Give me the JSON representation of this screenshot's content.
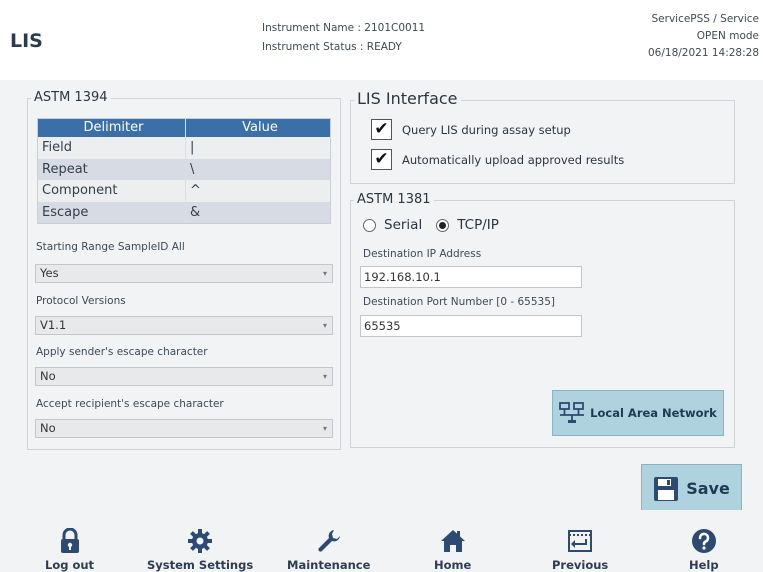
{
  "header": {
    "title": "LIS",
    "instrument_name": "Instrument Name : 2101C0011",
    "instrument_status": "Instrument Status : READY",
    "user": "ServicePSS / Service",
    "mode": "OPEN mode",
    "datetime": "06/18/2021 14:28:28"
  },
  "astm1394": {
    "legend": "ASTM 1394",
    "table_headers": [
      "Delimiter",
      "Value"
    ],
    "rows": [
      {
        "delimiter": "Field",
        "value": "|"
      },
      {
        "delimiter": "Repeat",
        "value": "\\"
      },
      {
        "delimiter": "Component",
        "value": "^"
      },
      {
        "delimiter": "Escape",
        "value": "&"
      }
    ],
    "starting_range_label": "Starting Range SampleID All",
    "starting_range_value": "Yes",
    "protocol_versions_label": "Protocol Versions",
    "protocol_versions_value": "V1.1",
    "sender_escape_label": "Apply sender's escape character",
    "sender_escape_value": "No",
    "recipient_escape_label": "Accept recipient's escape character",
    "recipient_escape_value": "No"
  },
  "lis_interface": {
    "legend": "LIS Interface",
    "query_lis_label": "Query LIS during assay setup",
    "query_lis_checked": true,
    "auto_upload_label": "Automatically upload approved results",
    "auto_upload_checked": true
  },
  "astm1381": {
    "legend": "ASTM 1381",
    "serial_label": "Serial",
    "tcpip_label": "TCP/IP",
    "selected_protocol": "TCP/IP",
    "dest_ip_label": "Destination IP Address",
    "dest_ip_value": "192.168.10.1",
    "dest_port_label": "Destination Port Number [0 - 65535]",
    "dest_port_value": "65535",
    "lan_button_label": "Local Area Network"
  },
  "save_label": "Save",
  "footer": {
    "logout": "Log out",
    "system_settings": "System Settings",
    "maintenance": "Maintenance",
    "home": "Home",
    "previous": "Previous",
    "help": "Help"
  },
  "colors": {
    "table_header": "#3b6fa8",
    "button_bg": "#aed3df",
    "nav_icon": "#2d4a73"
  }
}
